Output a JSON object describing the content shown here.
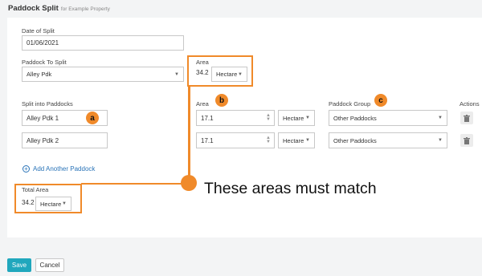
{
  "header": {
    "title": "Paddock Split",
    "subtitle": "for Example Property"
  },
  "form": {
    "date_label": "Date of Split",
    "date_value": "01/06/2021",
    "paddock_to_split_label": "Paddock To Split",
    "paddock_to_split_value": "Alley Pdk",
    "area_label": "Area",
    "area_value": "34.2",
    "area_unit": "Hectare"
  },
  "split": {
    "split_label": "Split into Paddocks",
    "area_col_label": "Area",
    "group_col_label": "Paddock Group",
    "actions_col_label": "Actions",
    "rows": [
      {
        "name": "Alley Pdk 1",
        "area": "17.1",
        "unit": "Hectare",
        "group": "Other Paddocks"
      },
      {
        "name": "Alley Pdk 2",
        "area": "17.1",
        "unit": "Hectare",
        "group": "Other Paddocks"
      }
    ],
    "add_label": "Add Another Paddock"
  },
  "total": {
    "label": "Total Area",
    "value": "34.2",
    "unit": "Hectare"
  },
  "annotations": {
    "a": "a",
    "b": "b",
    "c": "c",
    "note": "These areas must match"
  },
  "buttons": {
    "save": "Save",
    "cancel": "Cancel"
  },
  "colors": {
    "accent_orange": "#f08a2a",
    "save_button": "#20a7bd",
    "link_blue": "#2a74b8"
  },
  "icons": {
    "trash": "trash-icon",
    "add": "plus-circle-icon",
    "dropdown": "caret-down-icon",
    "spinner": "spinner-arrows-icon"
  }
}
